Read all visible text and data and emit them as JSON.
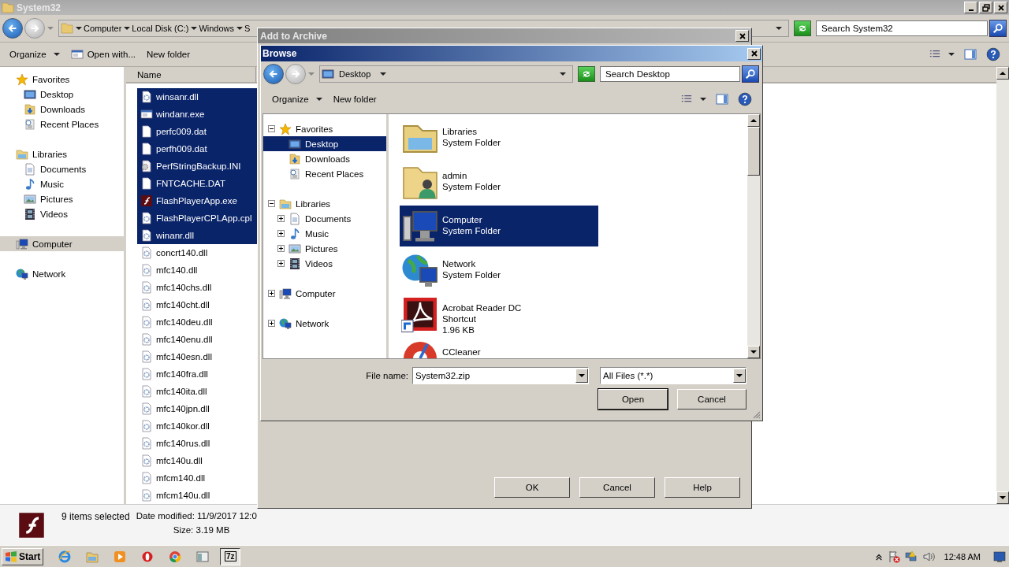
{
  "explorer": {
    "title": "System32",
    "breadcrumb": [
      "Computer",
      "Local Disk (C:)",
      "Windows",
      "S"
    ],
    "search_placeholder": "Search System32",
    "toolbar": [
      "Organize",
      "Open with...",
      "New folder"
    ],
    "nav": [
      {
        "label": "Favorites",
        "kind": "star",
        "selected": false,
        "children": [
          {
            "label": "Desktop",
            "kind": "desktop",
            "selected": false
          },
          {
            "label": "Downloads",
            "kind": "downloads",
            "selected": false
          },
          {
            "label": "Recent Places",
            "kind": "recent",
            "selected": false
          }
        ]
      },
      {
        "label": "Libraries",
        "kind": "library",
        "selected": false,
        "children": [
          {
            "label": "Documents",
            "kind": "documents",
            "selected": false
          },
          {
            "label": "Music",
            "kind": "music",
            "selected": false
          },
          {
            "label": "Pictures",
            "kind": "pictures",
            "selected": false
          },
          {
            "label": "Videos",
            "kind": "videos",
            "selected": false
          }
        ]
      },
      {
        "label": "Computer",
        "kind": "computer",
        "selected": true
      },
      {
        "label": "Network",
        "kind": "network",
        "selected": false
      }
    ],
    "column": "Name",
    "files": [
      {
        "name": "winsanr.dll",
        "kind": "dll",
        "selected": true
      },
      {
        "name": "windanr.exe",
        "kind": "exe",
        "selected": true
      },
      {
        "name": "perfc009.dat",
        "kind": "dat",
        "selected": true
      },
      {
        "name": "perfh009.dat",
        "kind": "dat",
        "selected": true
      },
      {
        "name": "PerfStringBackup.INI",
        "kind": "ini",
        "selected": true
      },
      {
        "name": "FNTCACHE.DAT",
        "kind": "dat",
        "selected": true
      },
      {
        "name": "FlashPlayerApp.exe",
        "kind": "flash",
        "selected": true
      },
      {
        "name": "FlashPlayerCPLApp.cpl",
        "kind": "dll",
        "selected": true
      },
      {
        "name": "winanr.dll",
        "kind": "dll",
        "selected": true
      },
      {
        "name": "concrt140.dll",
        "kind": "dll",
        "selected": false
      },
      {
        "name": "mfc140.dll",
        "kind": "dll",
        "selected": false
      },
      {
        "name": "mfc140chs.dll",
        "kind": "dll",
        "selected": false
      },
      {
        "name": "mfc140cht.dll",
        "kind": "dll",
        "selected": false
      },
      {
        "name": "mfc140deu.dll",
        "kind": "dll",
        "selected": false
      },
      {
        "name": "mfc140enu.dll",
        "kind": "dll",
        "selected": false
      },
      {
        "name": "mfc140esn.dll",
        "kind": "dll",
        "selected": false
      },
      {
        "name": "mfc140fra.dll",
        "kind": "dll",
        "selected": false
      },
      {
        "name": "mfc140ita.dll",
        "kind": "dll",
        "selected": false
      },
      {
        "name": "mfc140jpn.dll",
        "kind": "dll",
        "selected": false
      },
      {
        "name": "mfc140kor.dll",
        "kind": "dll",
        "selected": false
      },
      {
        "name": "mfc140rus.dll",
        "kind": "dll",
        "selected": false
      },
      {
        "name": "mfc140u.dll",
        "kind": "dll",
        "selected": false
      },
      {
        "name": "mfcm140.dll",
        "kind": "dll",
        "selected": false
      },
      {
        "name": "mfcm140u.dll",
        "kind": "dll",
        "selected": false
      }
    ],
    "details": {
      "summary": "9 items selected",
      "date_modified": "Date modified: 11/9/2017 12:0",
      "size": "Size: 3.19 MB"
    }
  },
  "archive_dialog": {
    "title": "Add to Archive",
    "buttons": [
      "OK",
      "Cancel",
      "Help"
    ]
  },
  "browse_dialog": {
    "title": "Browse",
    "location": "Desktop",
    "search_placeholder": "Search Desktop",
    "toolbar": [
      "Organize",
      "New folder"
    ],
    "tree": [
      {
        "label": "Favorites",
        "kind": "star",
        "expanded": true,
        "selected": false,
        "children": [
          {
            "label": "Desktop",
            "kind": "desktop",
            "selected": true
          },
          {
            "label": "Downloads",
            "kind": "downloads",
            "selected": false
          },
          {
            "label": "Recent Places",
            "kind": "recent",
            "selected": false
          }
        ]
      },
      {
        "label": "Libraries",
        "kind": "library",
        "expanded": true,
        "selected": false,
        "children": [
          {
            "label": "Documents",
            "kind": "documents",
            "expanded": false,
            "selected": false
          },
          {
            "label": "Music",
            "kind": "music",
            "expanded": false,
            "selected": false
          },
          {
            "label": "Pictures",
            "kind": "pictures",
            "expanded": false,
            "selected": false
          },
          {
            "label": "Videos",
            "kind": "videos",
            "expanded": false,
            "selected": false
          }
        ]
      },
      {
        "label": "Computer",
        "kind": "computer",
        "expanded": false,
        "selected": false
      },
      {
        "label": "Network",
        "kind": "network",
        "expanded": false,
        "selected": false
      }
    ],
    "items": [
      {
        "name": "Libraries",
        "lines": [
          "System Folder"
        ],
        "kind": "library",
        "selected": false
      },
      {
        "name": "admin",
        "lines": [
          "System Folder"
        ],
        "kind": "user",
        "selected": false
      },
      {
        "name": "Computer",
        "lines": [
          "System Folder"
        ],
        "kind": "computer",
        "selected": true
      },
      {
        "name": "Network",
        "lines": [
          "System Folder"
        ],
        "kind": "network",
        "selected": false
      },
      {
        "name": "Acrobat Reader DC",
        "lines": [
          "Shortcut",
          "1.96 KB"
        ],
        "kind": "acrobat",
        "selected": false
      },
      {
        "name": "CCleaner",
        "kind": "ccleaner",
        "selected": false
      }
    ],
    "file_name_label": "File name:",
    "file_name": "System32.zip",
    "filter": "All Files (*.*)",
    "buttons": [
      {
        "label": "Open",
        "default": true
      },
      {
        "label": "Cancel",
        "default": false
      }
    ]
  },
  "taskbar": {
    "start": "Start",
    "apps": [
      {
        "kind": "ie",
        "active": false
      },
      {
        "kind": "explorer",
        "active": false
      },
      {
        "kind": "media",
        "active": false
      },
      {
        "kind": "opera",
        "active": false
      },
      {
        "kind": "chrome",
        "active": false
      },
      {
        "kind": "window",
        "active": false
      },
      {
        "kind": "sevenzip",
        "label": "7z",
        "active": true
      }
    ],
    "clock": "12:48 AM"
  }
}
